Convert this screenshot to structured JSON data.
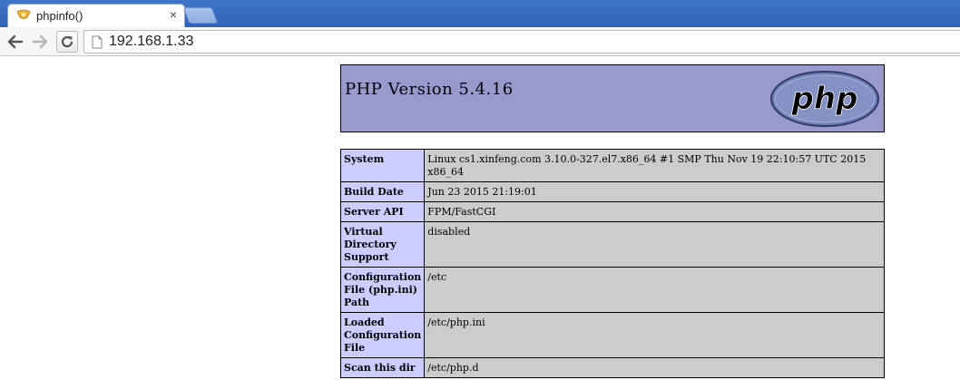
{
  "browser": {
    "tab_title": "phpinfo()",
    "tab_close_glyph": "×",
    "url": "192.168.1.33",
    "icons": [
      "php-favicon-icon",
      "close-icon",
      "back-arrow-icon",
      "forward-arrow-icon",
      "reload-icon",
      "page-icon"
    ]
  },
  "page": {
    "header": {
      "title": "PHP Version 5.4.16",
      "logo_text": "php",
      "background_color": "#9999cc"
    },
    "info_table": {
      "label_color": "#ccccff",
      "value_color": "#cccccc",
      "rows": [
        {
          "key": "System",
          "value": "Linux cs1.xinfeng.com 3.10.0-327.el7.x86_64 #1 SMP Thu Nov 19 22:10:57 UTC 2015 x86_64"
        },
        {
          "key": "Build Date",
          "value": "Jun 23 2015 21:19:01"
        },
        {
          "key": "Server API",
          "value": "FPM/FastCGI"
        },
        {
          "key": "Virtual Directory Support",
          "value": "disabled"
        },
        {
          "key": "Configuration File (php.ini) Path",
          "value": "/etc"
        },
        {
          "key": "Loaded Configuration File",
          "value": "/etc/php.ini"
        },
        {
          "key": "Scan this dir",
          "value": "/etc/php.d"
        }
      ]
    }
  }
}
